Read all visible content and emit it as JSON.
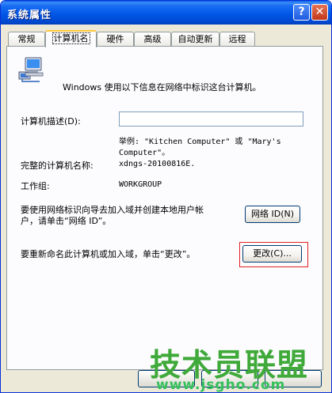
{
  "window": {
    "title": "系统属性"
  },
  "titlebar": {
    "help_glyph": "?",
    "close_glyph": "✕"
  },
  "tabs": [
    {
      "label": "常规"
    },
    {
      "label": "计算机名",
      "active": true
    },
    {
      "label": "硬件"
    },
    {
      "label": "高级"
    },
    {
      "label": "自动更新"
    },
    {
      "label": "远程"
    }
  ],
  "intro": "Windows 使用以下信息在网络中标识这台计算机。",
  "description": {
    "label": "计算机描述(D):",
    "value": "",
    "example_line1": "举例: \"Kitchen Computer\" 或 \"Mary's",
    "example_line2": "Computer\"。"
  },
  "full_name": {
    "label": "完整的计算机名称:",
    "value": "xdngs-20100816E."
  },
  "workgroup": {
    "label": "工作组:",
    "value": "WORKGROUP"
  },
  "network_id": {
    "text_line1": "要使用网络标识向导去加入域并创建本地用户帐",
    "text_line2": "户，请单击“网络 ID”。",
    "button": "网络 ID(N)"
  },
  "rename": {
    "text": "要重新命名此计算机或加入域，单击“更改”。",
    "button": "更改(C)..."
  },
  "watermark": {
    "main": "技术员联盟",
    "sub": "www.jsgho.com"
  },
  "colors": {
    "title_bar": "#0055e5",
    "tab_highlight": "#ffc83c",
    "annotation_box": "#e02020",
    "watermark": "#3fa93a"
  }
}
